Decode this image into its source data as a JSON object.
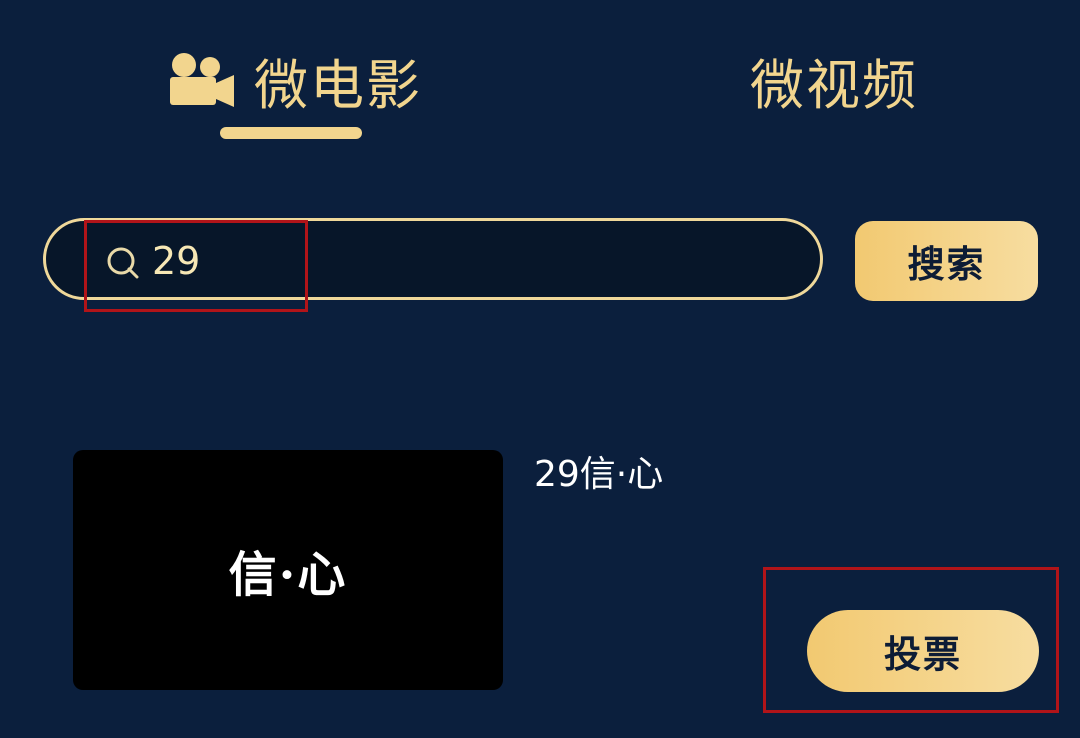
{
  "tabs": {
    "micro_film": {
      "label": "微电影",
      "icon": "camera-icon",
      "active": true
    },
    "micro_video": {
      "label": "微视频",
      "active": false
    }
  },
  "search": {
    "value": "29",
    "icon": "search-icon",
    "button_label": "搜索"
  },
  "results": [
    {
      "thumbnail_text": "信·心",
      "title": "29信·心",
      "vote_label": "投票"
    }
  ],
  "colors": {
    "background": "#0b1f3d",
    "accent": "#f2d58e",
    "annotation": "#b11419"
  }
}
